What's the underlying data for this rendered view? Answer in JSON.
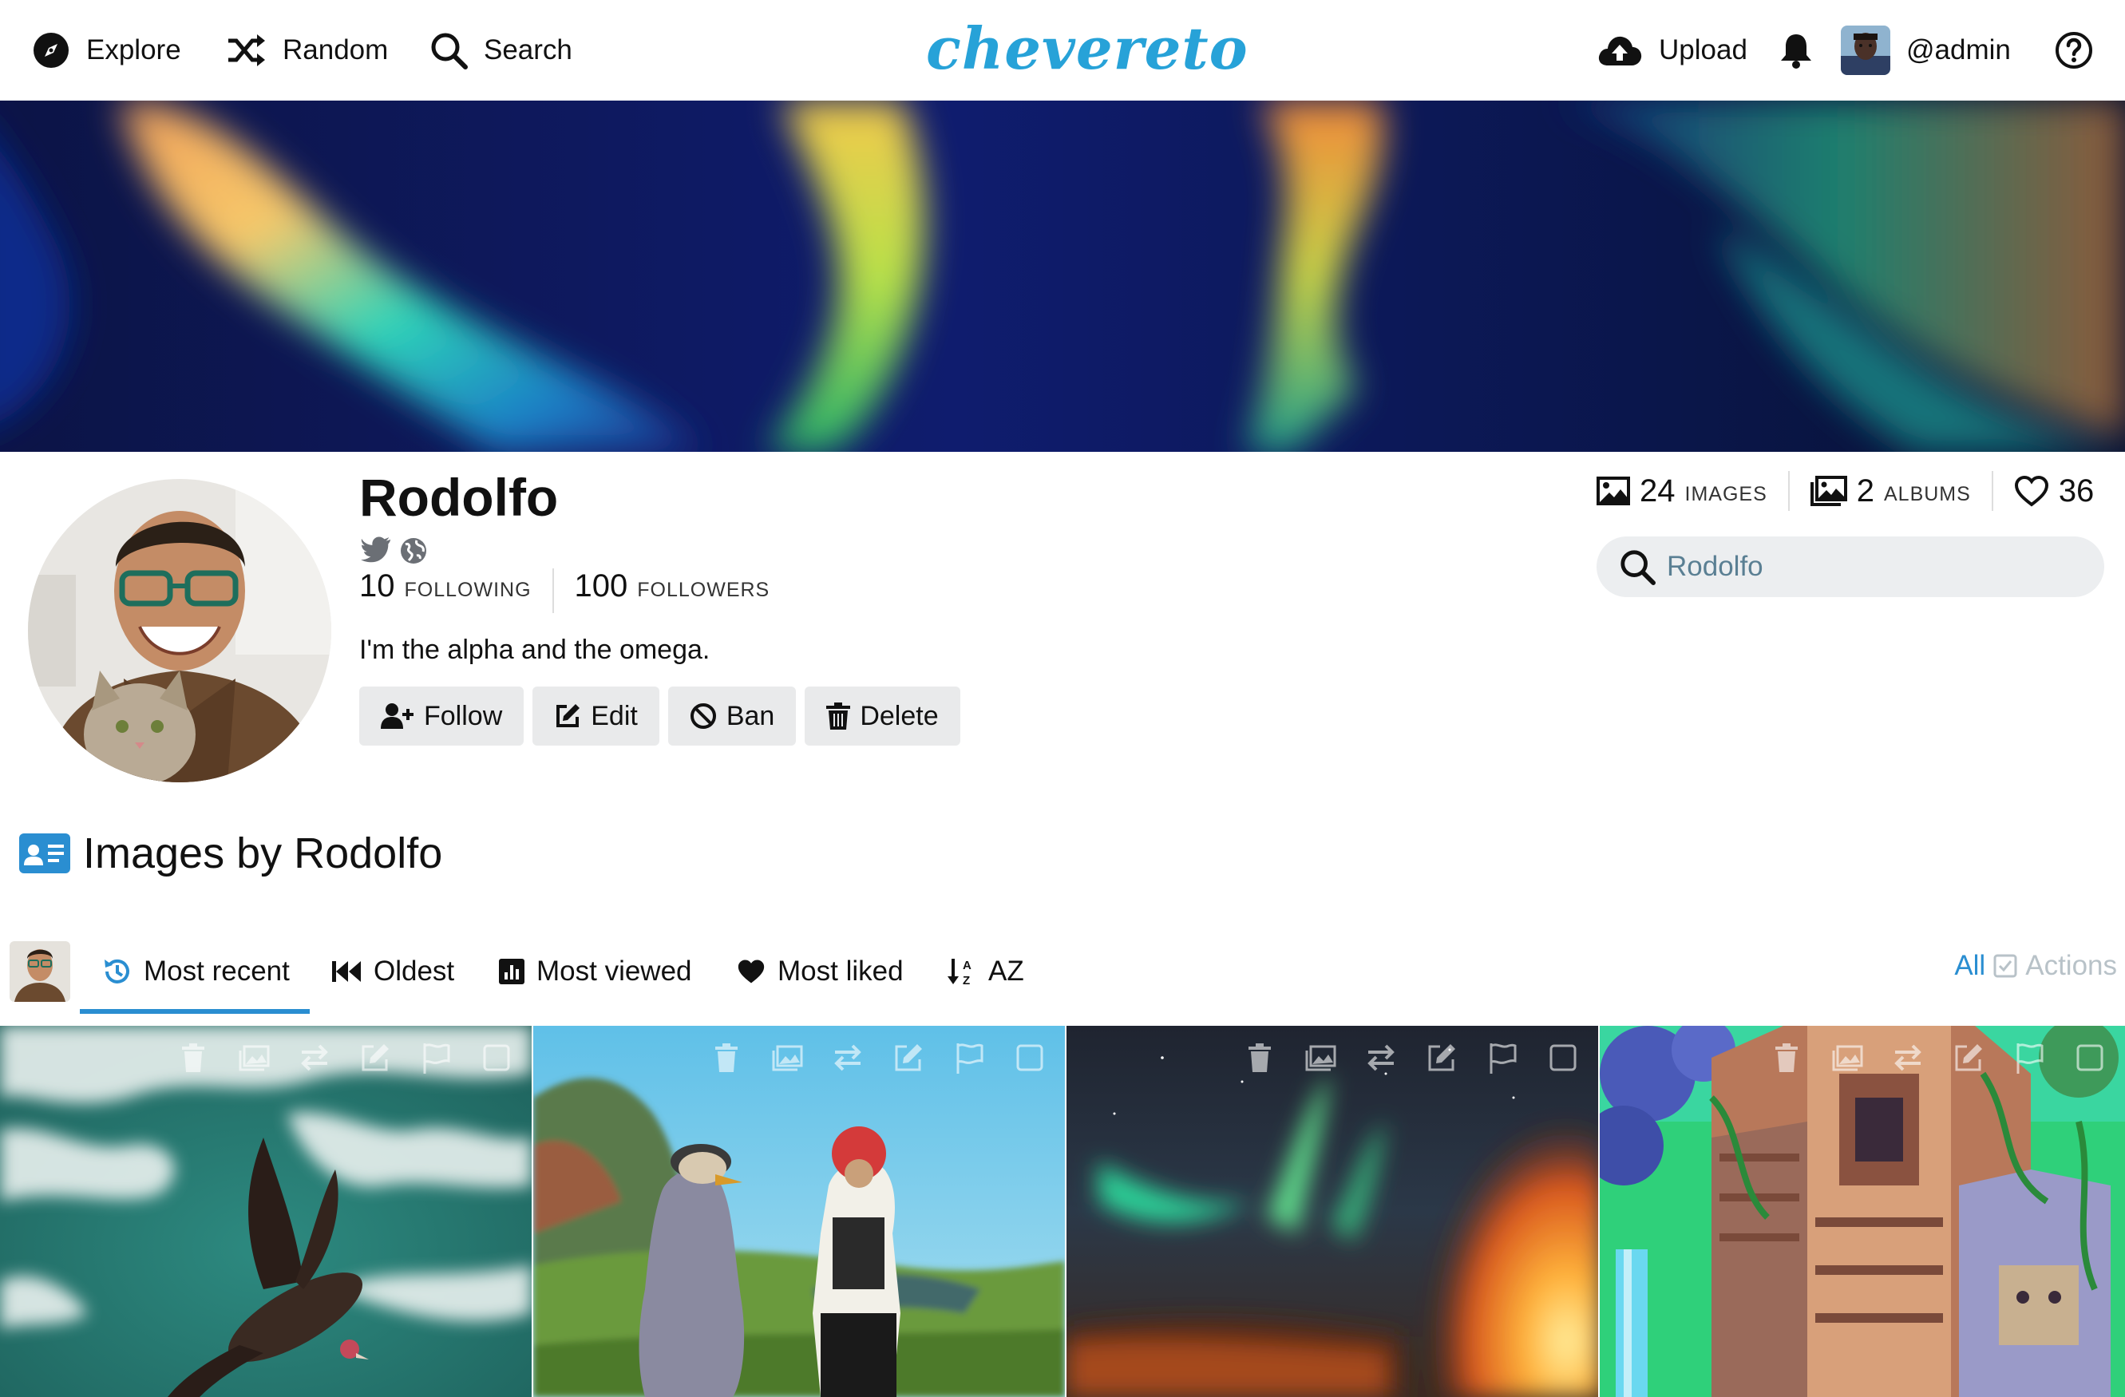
{
  "nav": {
    "explore": "Explore",
    "random": "Random",
    "search": "Search",
    "logo": "chevereto",
    "upload": "Upload",
    "user": "@admin"
  },
  "profile": {
    "name": "Rodolfo",
    "following_count": "10",
    "following_label": "FOLLOWING",
    "followers_count": "100",
    "followers_label": "FOLLOWERS",
    "bio": "I'm the alpha and the omega.",
    "buttons": {
      "follow": "Follow",
      "edit": "Edit",
      "ban": "Ban",
      "delete": "Delete"
    }
  },
  "stats": {
    "images_count": "24",
    "images_label": "IMAGES",
    "albums_count": "2",
    "albums_label": "ALBUMS",
    "likes_count": "36"
  },
  "search": {
    "placeholder": "Rodolfo"
  },
  "section": {
    "title": "Images by Rodolfo"
  },
  "tabs": {
    "most_recent": "Most recent",
    "oldest": "Oldest",
    "most_viewed": "Most viewed",
    "most_liked": "Most liked",
    "az": "AZ",
    "all": "All",
    "actions": "Actions"
  },
  "grid": {
    "items": [
      {
        "subject": "vulture flying over sea"
      },
      {
        "subject": "painting of two figures in a field"
      },
      {
        "subject": "aurora over lava"
      },
      {
        "subject": "isometric jungle temple"
      }
    ]
  },
  "colors": {
    "accent": "#27a2d8",
    "tab_active": "#2a8ed1",
    "button_bg": "#e9eaeb",
    "search_bg": "#eceef0"
  }
}
